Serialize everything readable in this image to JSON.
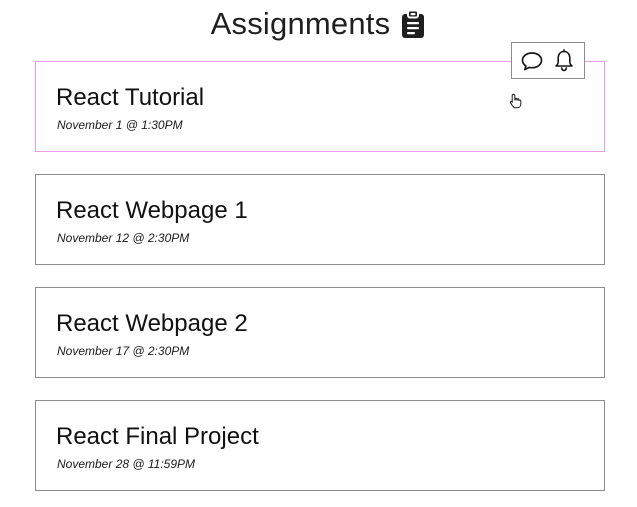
{
  "header": {
    "title": "Assignments",
    "icon": "clipboard-icon"
  },
  "assignments": [
    {
      "title": "React Tutorial",
      "due": "November 1 @ 1:30PM",
      "hovered": true
    },
    {
      "title": "React Webpage 1",
      "due": "November 12 @ 2:30PM",
      "hovered": false
    },
    {
      "title": "React Webpage 2",
      "due": "November 17 @ 2:30PM",
      "hovered": false
    },
    {
      "title": "React Final Project",
      "due": "November 28 @ 11:59PM",
      "hovered": false
    }
  ],
  "hover_actions": {
    "icons": [
      "chat-bubble-icon",
      "bell-icon"
    ]
  },
  "colors": {
    "hover_border": "#ec9cec",
    "card_border": "#8c8c8c",
    "text": "#111111"
  },
  "cursor_icon": "pointer-hand-icon"
}
